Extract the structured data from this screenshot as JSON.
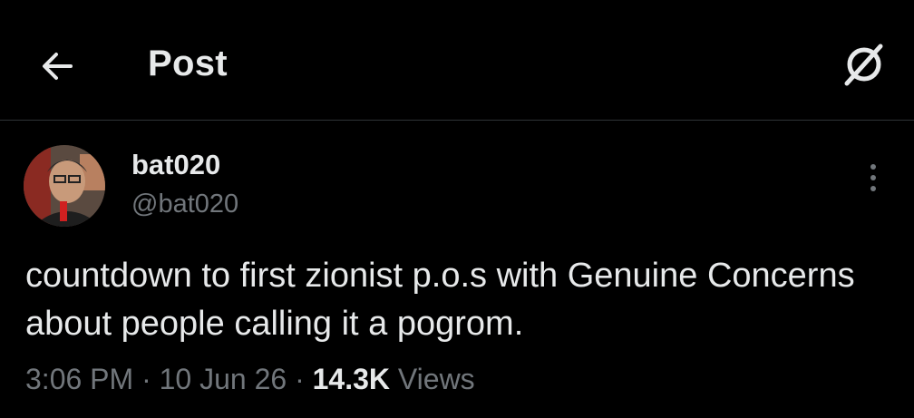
{
  "header": {
    "title": "Post",
    "back_icon": "arrow-left-icon",
    "grok_icon": "grok-icon"
  },
  "author": {
    "display_name": "bat020",
    "handle": "@bat020",
    "avatar_icon": "user-avatar"
  },
  "post": {
    "text": "countdown to first zionist p.o.s with Genuine Concerns about people calling it a pogrom.",
    "time": "3:06 PM",
    "separator": "·",
    "date": "10 Jun 26",
    "views_count": "14.3K",
    "views_label": "Views",
    "more_icon": "more-vertical-icon"
  },
  "colors": {
    "background": "#000000",
    "text_primary": "#e7e9ea",
    "text_secondary": "#71767b",
    "divider": "#2f3336"
  }
}
